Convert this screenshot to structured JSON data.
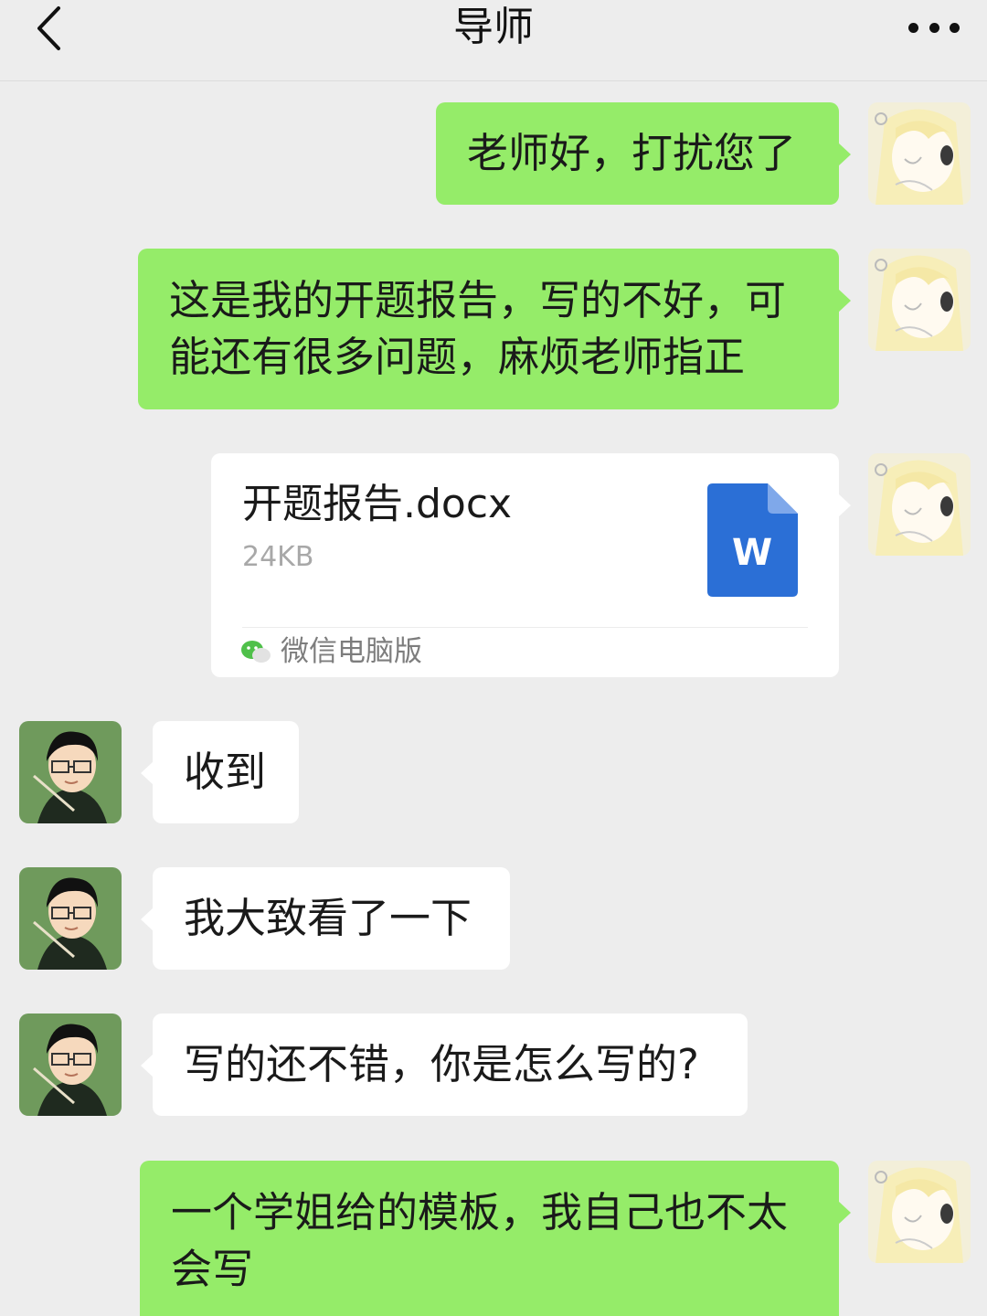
{
  "header": {
    "title": "导师"
  },
  "messages": {
    "m1": {
      "text": "老师好，打扰您了"
    },
    "m2": {
      "line1": "这是我的开题报告，写的不好，可",
      "line2": "能还有很多问题，麻烦老师指正"
    },
    "file": {
      "name": "开题报告.docx",
      "size": "24KB",
      "icon_letter": "W",
      "source": "微信电脑版"
    },
    "m4": {
      "text": "收到"
    },
    "m5": {
      "text": "我大致看了一下"
    },
    "m6": {
      "text": "写的还不错，你是怎么写的?"
    },
    "m7": {
      "line1": "一个学姐给的模板，我自己也不太",
      "line2": "会写"
    }
  },
  "colors": {
    "sent_bubble": "#95ec69",
    "received_bubble": "#ffffff",
    "background": "#ededed",
    "word_icon": "#2b6fd6"
  },
  "icons": {
    "back": "chevron-left-icon",
    "more": "more-dots-icon",
    "file": "word-document-icon",
    "source": "wechat-icon"
  }
}
